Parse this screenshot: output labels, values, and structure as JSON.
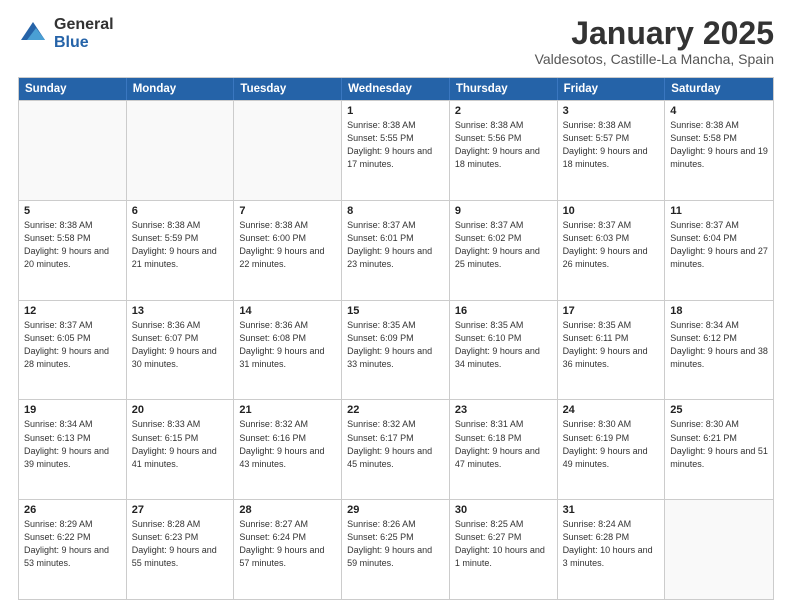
{
  "logo": {
    "general": "General",
    "blue": "Blue"
  },
  "title": "January 2025",
  "subtitle": "Valdesotos, Castille-La Mancha, Spain",
  "days": [
    "Sunday",
    "Monday",
    "Tuesday",
    "Wednesday",
    "Thursday",
    "Friday",
    "Saturday"
  ],
  "weeks": [
    [
      {
        "date": "",
        "empty": true
      },
      {
        "date": "",
        "empty": true
      },
      {
        "date": "",
        "empty": true
      },
      {
        "date": "1",
        "sunrise": "8:38 AM",
        "sunset": "5:55 PM",
        "daylight": "9 hours and 17 minutes."
      },
      {
        "date": "2",
        "sunrise": "8:38 AM",
        "sunset": "5:56 PM",
        "daylight": "9 hours and 18 minutes."
      },
      {
        "date": "3",
        "sunrise": "8:38 AM",
        "sunset": "5:57 PM",
        "daylight": "9 hours and 18 minutes."
      },
      {
        "date": "4",
        "sunrise": "8:38 AM",
        "sunset": "5:58 PM",
        "daylight": "9 hours and 19 minutes."
      }
    ],
    [
      {
        "date": "5",
        "sunrise": "8:38 AM",
        "sunset": "5:58 PM",
        "daylight": "9 hours and 20 minutes."
      },
      {
        "date": "6",
        "sunrise": "8:38 AM",
        "sunset": "5:59 PM",
        "daylight": "9 hours and 21 minutes."
      },
      {
        "date": "7",
        "sunrise": "8:38 AM",
        "sunset": "6:00 PM",
        "daylight": "9 hours and 22 minutes."
      },
      {
        "date": "8",
        "sunrise": "8:37 AM",
        "sunset": "6:01 PM",
        "daylight": "9 hours and 23 minutes."
      },
      {
        "date": "9",
        "sunrise": "8:37 AM",
        "sunset": "6:02 PM",
        "daylight": "9 hours and 25 minutes."
      },
      {
        "date": "10",
        "sunrise": "8:37 AM",
        "sunset": "6:03 PM",
        "daylight": "9 hours and 26 minutes."
      },
      {
        "date": "11",
        "sunrise": "8:37 AM",
        "sunset": "6:04 PM",
        "daylight": "9 hours and 27 minutes."
      }
    ],
    [
      {
        "date": "12",
        "sunrise": "8:37 AM",
        "sunset": "6:05 PM",
        "daylight": "9 hours and 28 minutes."
      },
      {
        "date": "13",
        "sunrise": "8:36 AM",
        "sunset": "6:07 PM",
        "daylight": "9 hours and 30 minutes."
      },
      {
        "date": "14",
        "sunrise": "8:36 AM",
        "sunset": "6:08 PM",
        "daylight": "9 hours and 31 minutes."
      },
      {
        "date": "15",
        "sunrise": "8:35 AM",
        "sunset": "6:09 PM",
        "daylight": "9 hours and 33 minutes."
      },
      {
        "date": "16",
        "sunrise": "8:35 AM",
        "sunset": "6:10 PM",
        "daylight": "9 hours and 34 minutes."
      },
      {
        "date": "17",
        "sunrise": "8:35 AM",
        "sunset": "6:11 PM",
        "daylight": "9 hours and 36 minutes."
      },
      {
        "date": "18",
        "sunrise": "8:34 AM",
        "sunset": "6:12 PM",
        "daylight": "9 hours and 38 minutes."
      }
    ],
    [
      {
        "date": "19",
        "sunrise": "8:34 AM",
        "sunset": "6:13 PM",
        "daylight": "9 hours and 39 minutes."
      },
      {
        "date": "20",
        "sunrise": "8:33 AM",
        "sunset": "6:15 PM",
        "daylight": "9 hours and 41 minutes."
      },
      {
        "date": "21",
        "sunrise": "8:32 AM",
        "sunset": "6:16 PM",
        "daylight": "9 hours and 43 minutes."
      },
      {
        "date": "22",
        "sunrise": "8:32 AM",
        "sunset": "6:17 PM",
        "daylight": "9 hours and 45 minutes."
      },
      {
        "date": "23",
        "sunrise": "8:31 AM",
        "sunset": "6:18 PM",
        "daylight": "9 hours and 47 minutes."
      },
      {
        "date": "24",
        "sunrise": "8:30 AM",
        "sunset": "6:19 PM",
        "daylight": "9 hours and 49 minutes."
      },
      {
        "date": "25",
        "sunrise": "8:30 AM",
        "sunset": "6:21 PM",
        "daylight": "9 hours and 51 minutes."
      }
    ],
    [
      {
        "date": "26",
        "sunrise": "8:29 AM",
        "sunset": "6:22 PM",
        "daylight": "9 hours and 53 minutes."
      },
      {
        "date": "27",
        "sunrise": "8:28 AM",
        "sunset": "6:23 PM",
        "daylight": "9 hours and 55 minutes."
      },
      {
        "date": "28",
        "sunrise": "8:27 AM",
        "sunset": "6:24 PM",
        "daylight": "9 hours and 57 minutes."
      },
      {
        "date": "29",
        "sunrise": "8:26 AM",
        "sunset": "6:25 PM",
        "daylight": "9 hours and 59 minutes."
      },
      {
        "date": "30",
        "sunrise": "8:25 AM",
        "sunset": "6:27 PM",
        "daylight": "10 hours and 1 minute."
      },
      {
        "date": "31",
        "sunrise": "8:24 AM",
        "sunset": "6:28 PM",
        "daylight": "10 hours and 3 minutes."
      },
      {
        "date": "",
        "empty": true
      }
    ]
  ]
}
